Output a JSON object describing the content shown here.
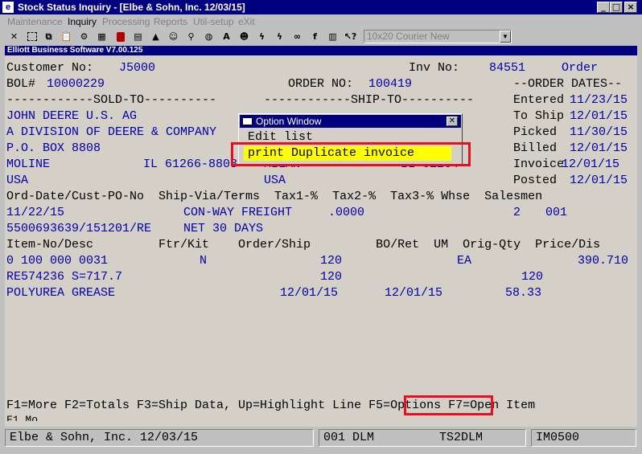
{
  "window": {
    "title": "Stock Status Inquiry - [Elbe & Sohn, Inc. 12/03/15]",
    "app_icon": "app-logo-icon",
    "controls": [
      "minimize-icon",
      "maximize-icon",
      "close-icon"
    ]
  },
  "menu": [
    {
      "label": "Maintenance",
      "enabled": false
    },
    {
      "label": "Inquiry",
      "enabled": true
    },
    {
      "label": "Processing",
      "enabled": false
    },
    {
      "label": "Reports",
      "enabled": false
    },
    {
      "label": "Util-setup",
      "enabled": false
    },
    {
      "label": "eXit",
      "enabled": false
    }
  ],
  "toolbar": {
    "icons": [
      "close-x-icon",
      "select-icon",
      "copy-icon",
      "paste-icon",
      "settings-icon",
      "calculator-icon",
      "stop-icon",
      "print-icon",
      "warning-icon",
      "person-icon",
      "search-icon",
      "globe-icon",
      "font-icon",
      "user-icon",
      "lightning-icon",
      "lightning2-icon",
      "link-icon",
      "function-icon",
      "notes-icon",
      "help-pointer-icon"
    ],
    "font_select": "10x20 Courier New"
  },
  "subtitle": "Elliott Business Software V7.00.125",
  "terminal": {
    "customer_label": "Customer No:",
    "customer_no": "J5000",
    "inv_label": "Inv No:",
    "inv_no": "84551",
    "order_label": "Order",
    "bol_label": "BOL#",
    "bol_no": "10000229",
    "order_no_label": "ORDER NO:",
    "order_no": "100419",
    "order_dates_label": "--ORDER DATES--",
    "sold_to_header": "------------SOLD-TO----------",
    "ship_to_header": "------------SHIP-TO----------",
    "sold_to": [
      "JOHN DEERE U.S. AG",
      "A DIVISION OF DEERE & COMPANY",
      "P.O. BOX 8808",
      "MOLINE",
      "USA"
    ],
    "sold_to_state_zip": "IL 61266-8808",
    "ship_to_partial": [
      "MILAN",
      "USA"
    ],
    "ship_to_state_zip": "IL 61264",
    "dates": [
      {
        "label": "Entered",
        "value": "11/23/15"
      },
      {
        "label": "To Ship",
        "value": "12/01/15"
      },
      {
        "label": "Picked",
        "value": "11/30/15"
      },
      {
        "label": "Billed",
        "value": "12/01/15"
      },
      {
        "label": "Invoice",
        "value": "12/01/15"
      },
      {
        "label": "Posted",
        "value": "12/01/15"
      }
    ],
    "header_row": "Ord-Date/Cust-PO-No  Ship-Via/Terms  Tax1-%  Tax2-%  Tax3-% Whse  Salesmen",
    "ord_date": "11/22/15",
    "ship_via": "CON-WAY FREIGHT",
    "tax1": ".0000",
    "whse": "2",
    "salesman": "001",
    "cust_po": "5500693639/151201/RE",
    "terms": "NET 30 DAYS",
    "item_header": "Item-No/Desc         Ftr/Kit    Order/Ship         BO/Ret  UM  Orig-Qty  Price/Dis",
    "item": {
      "item_no": "0 100 000 0031",
      "ftr": "N",
      "order_qty": "120",
      "um": "EA",
      "price": "390.710",
      "desc1": "RE574236 S=717.7",
      "ship_qty": "120",
      "orig_qty": "120",
      "desc2": "POLYUREA GREASE",
      "date1": "12/01/15",
      "date2": "12/01/15",
      "amount": "58.33"
    },
    "function_keys": {
      "prefix": "F1=More F2=Totals F3=Ship Data, Up=Highlight Line",
      "options": "F5=Options",
      "suffix": "F7=Open Item"
    }
  },
  "option_window": {
    "title": "Option Window",
    "items": [
      "Edit list",
      "print Duplicate invoice"
    ],
    "selected_index": 1
  },
  "status_bar": {
    "company": "Elbe & Sohn, Inc. 12/03/15",
    "company_code": "001 DLM",
    "terminal": "TS2DLM",
    "screen_code": "IM0500"
  },
  "colors": {
    "title_bar": "#000080",
    "terminal_bg": "#d4d0c8",
    "text_blue": "#0000a8",
    "highlight": "#ffff00",
    "callout_red": "#e8101e"
  }
}
